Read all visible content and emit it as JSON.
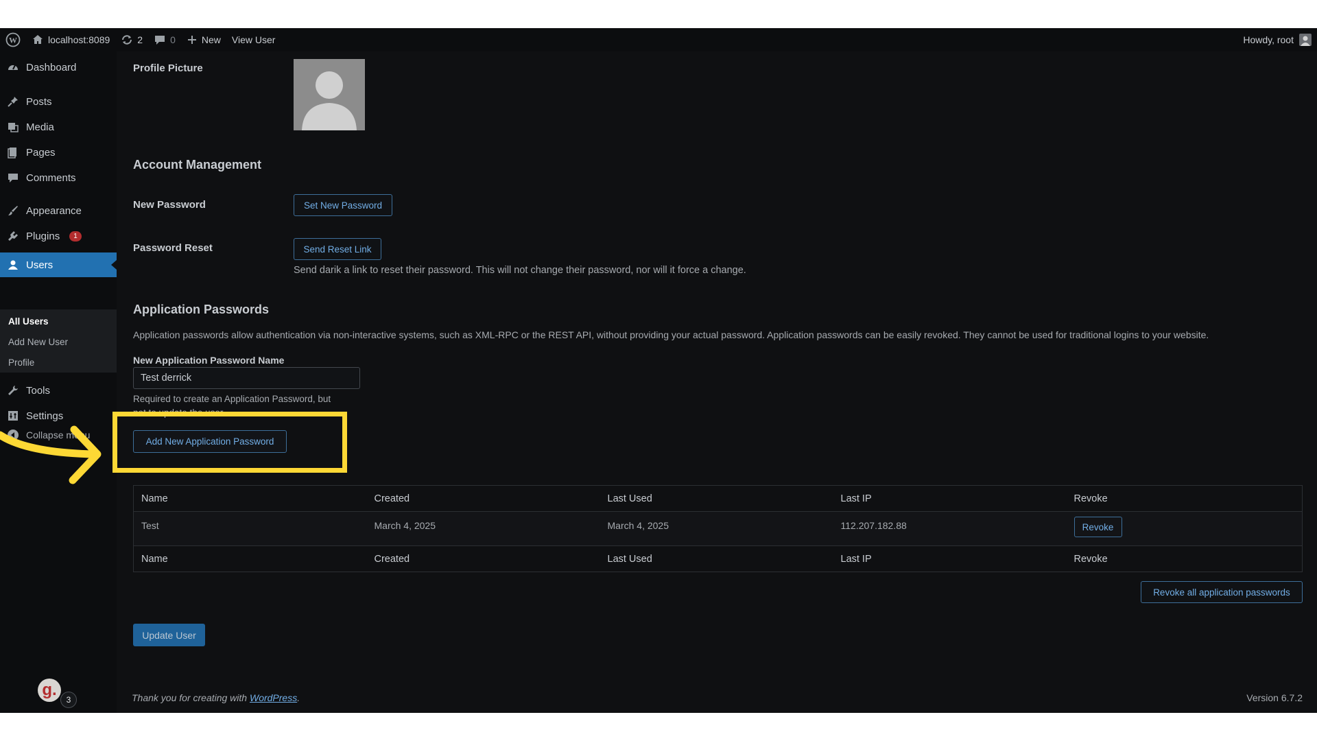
{
  "adminbar": {
    "site_name": "localhost:8089",
    "updates_count": "2",
    "comments_count": "0",
    "new_label": "New",
    "view_user_label": "View User",
    "greeting": "Howdy, root"
  },
  "sidebar": {
    "dashboard": "Dashboard",
    "posts": "Posts",
    "media": "Media",
    "pages": "Pages",
    "comments": "Comments",
    "appearance": "Appearance",
    "plugins": "Plugins",
    "plugins_badge": "1",
    "users": "Users",
    "submenu": {
      "all_users": "All Users",
      "add_new_user": "Add New User",
      "profile": "Profile"
    },
    "tools": "Tools",
    "settings": "Settings",
    "collapse": "Collapse menu",
    "widget_logo": "g.",
    "widget_count": "3"
  },
  "profile": {
    "picture_label": "Profile Picture"
  },
  "account": {
    "heading": "Account Management",
    "new_password_label": "New Password",
    "set_password_button": "Set New Password",
    "reset_label": "Password Reset",
    "reset_button": "Send Reset Link",
    "reset_desc": "Send darik a link to reset their password. This will not change their password, nor will it force a change."
  },
  "app_passwords": {
    "heading": "Application Passwords",
    "description": "Application passwords allow authentication via non-interactive systems, such as XML-RPC or the REST API, without providing your actual password. Application passwords can be easily revoked. They cannot be used for traditional logins to your website.",
    "name_label": "New Application Password Name",
    "name_value": "Test derrick",
    "help_text_line1": "Required to create an Application Password, but",
    "help_text_line2": "not to update the user.",
    "add_button": "Add New Application Password",
    "columns": [
      "Name",
      "Created",
      "Last Used",
      "Last IP",
      "Revoke"
    ],
    "rows": [
      {
        "name": "Test",
        "created": "March 4, 2025",
        "last_used": "March 4, 2025",
        "last_ip": "112.207.182.88",
        "revoke": "Revoke"
      }
    ],
    "revoke_all_button": "Revoke all application passwords"
  },
  "update_button": "Update User",
  "footer": {
    "thanks_prefix": "Thank you for creating with ",
    "thanks_link": "WordPress",
    "thanks_suffix": ".",
    "version": "Version 6.7.2"
  },
  "colors": {
    "highlight": "#fdd835",
    "accent": "#2271b1",
    "link": "#72aee6"
  }
}
